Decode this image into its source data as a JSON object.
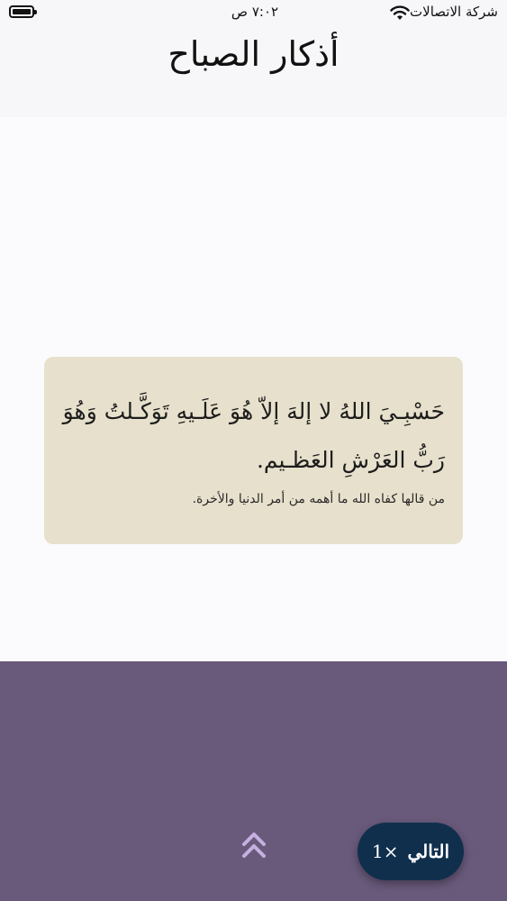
{
  "status_bar": {
    "carrier": "شركة الاتصالات",
    "time": "٧:٠٢ ص",
    "icons": [
      "wifi-icon",
      "battery-icon"
    ]
  },
  "header": {
    "title": "أذكار الصباح"
  },
  "card": {
    "dhikr_text": "حَسْبِـيَ اللهُ لا إلهَ إلاّ هُوَ عَلَـيهِ تَوَكَّـلتُ وَهُوَ رَبُّ العَرْشِ العَظـيم.",
    "virtue_text": "من قالها كفاه الله ما أهمه من أمر الدنيا والأخرة."
  },
  "bottom": {
    "up_icon": "double-chevron-up-icon",
    "next_label": "التالي",
    "count_label": "1×"
  },
  "colors": {
    "card_bg": "#e7e0cc",
    "panel_bg": "#695a7b",
    "button_bg": "#0f2f4d",
    "chevron": "#c6b0e0"
  }
}
